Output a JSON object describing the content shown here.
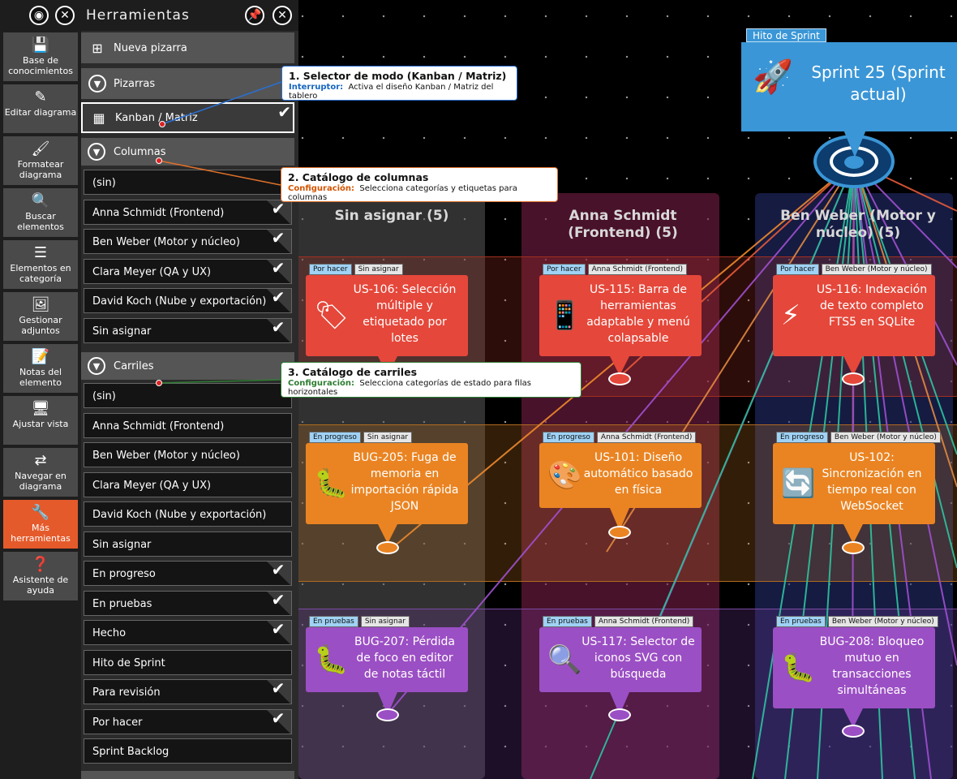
{
  "panel": {
    "title": "Herramientas"
  },
  "sidebar": {
    "items": [
      {
        "label": "Base de conocimientos",
        "icon": "save-icon"
      },
      {
        "label": "Editar diagrama",
        "icon": "pencil-icon"
      },
      {
        "label": "Formatear diagrama",
        "icon": "brush-icon"
      },
      {
        "label": "Buscar elementos",
        "icon": "search-icon"
      },
      {
        "label": "Elementos en categoría",
        "icon": "category-list-icon"
      },
      {
        "label": "Gestionar adjuntos",
        "icon": "image-attachment-icon"
      },
      {
        "label": "Notas del elemento",
        "icon": "notes-icon"
      },
      {
        "label": "Ajustar vista",
        "icon": "monitor-icon"
      },
      {
        "label": "Navegar en diagrama",
        "icon": "arrows-swap-icon"
      },
      {
        "label": "Más herramientas",
        "icon": "wrench-icon"
      },
      {
        "label": "Asistente de ayuda",
        "icon": "help-icon"
      }
    ]
  },
  "tools": {
    "new_board": "Nueva pizarra",
    "boards": "Pizarras",
    "kanban": "Kanban / Matriz",
    "columns_head": "Columnas",
    "lanes_head": "Carriles"
  },
  "columns": [
    {
      "label": "(sin)",
      "checked": false
    },
    {
      "label": "Anna Schmidt (Frontend)",
      "checked": true
    },
    {
      "label": "Ben Weber (Motor y núcleo)",
      "checked": true
    },
    {
      "label": "Clara Meyer (QA y UX)",
      "checked": true
    },
    {
      "label": "David Koch (Nube y exportación)",
      "checked": true
    },
    {
      "label": "Sin asignar",
      "checked": true
    }
  ],
  "lanes": [
    {
      "label": "(sin)",
      "checked": false
    },
    {
      "label": "Anna Schmidt (Frontend)",
      "checked": false
    },
    {
      "label": "Ben Weber (Motor y núcleo)",
      "checked": false
    },
    {
      "label": "Clara Meyer (QA y UX)",
      "checked": false
    },
    {
      "label": "David Koch (Nube y exportación)",
      "checked": false
    },
    {
      "label": "Sin asignar",
      "checked": false
    },
    {
      "label": "En progreso",
      "checked": true
    },
    {
      "label": "En pruebas",
      "checked": true
    },
    {
      "label": "Hecho",
      "checked": true
    },
    {
      "label": "Hito de Sprint",
      "checked": false
    },
    {
      "label": "Para revisión",
      "checked": true
    },
    {
      "label": "Por hacer",
      "checked": true
    },
    {
      "label": "Sprint Backlog",
      "checked": false
    }
  ],
  "callouts": [
    {
      "title": "1. Selector de modo (Kanban / Matriz)",
      "kind": "Interruptor:",
      "text": "Activa el diseño Kanban / Matriz del tablero",
      "kind_color": "#1565c0"
    },
    {
      "title": "2. Catálogo de columnas",
      "kind": "Configuración:",
      "text": "Selecciona categorías y etiquetas para columnas",
      "kind_color": "#d35400"
    },
    {
      "title": "3. Catálogo de carriles",
      "kind": "Configuración:",
      "text": "Selecciona categorías de estado para filas horizontales",
      "kind_color": "#2e7d32"
    }
  ],
  "board": {
    "milestone_tag": "Hito de Sprint",
    "milestone_title": "Sprint 25 (Sprint actual)",
    "columns": [
      "Sin asignar (5)",
      "Anna Schmidt (Frontend) (5)",
      "Ben Weber (Motor y núcleo) (5)"
    ],
    "cards": [
      {
        "status": "Por hacer",
        "owner": "Sin asignar",
        "title": "US-106: Selección múltiple y etiquetado por lotes",
        "icon": "tag-icon",
        "glyph": "🏷",
        "color": "#e5473a"
      },
      {
        "status": "Por hacer",
        "owner": "Anna Schmidt (Frontend)",
        "title": "US-115: Barra de herramientas adaptable y menú colapsable",
        "icon": "phone-icon",
        "glyph": "📱",
        "color": "#e5473a"
      },
      {
        "status": "Por hacer",
        "owner": "Ben Weber (Motor y núcleo)",
        "title": "US-116: Indexación de texto completo FTS5 en SQLite",
        "icon": "lightning-icon",
        "glyph": "⚡",
        "color": "#e5473a"
      },
      {
        "status": "En progreso",
        "owner": "Sin asignar",
        "title": "BUG-205: Fuga de memoria en importación rápida JSON",
        "icon": "bug-icon",
        "glyph": "🐛",
        "color": "#ea8422"
      },
      {
        "status": "En progreso",
        "owner": "Anna Schmidt (Frontend)",
        "title": "US-101: Diseño automático basado en física",
        "icon": "palette-icon",
        "glyph": "🎨",
        "color": "#ea8422"
      },
      {
        "status": "En progreso",
        "owner": "Ben Weber (Motor y núcleo)",
        "title": "US-102: Sincronización en tiempo real con WebSocket",
        "icon": "sync-icon",
        "glyph": "🔄",
        "color": "#ea8422"
      },
      {
        "status": "En pruebas",
        "owner": "Sin asignar",
        "title": "BUG-207: Pérdida de foco en editor de notas táctil",
        "icon": "bug-icon",
        "glyph": "🐛",
        "color": "#9b4fc4"
      },
      {
        "status": "En pruebas",
        "owner": "Anna Schmidt (Frontend)",
        "title": "US-117: Selector de iconos SVG con búsqueda",
        "icon": "magnifier-icon",
        "glyph": "🔍",
        "color": "#9b4fc4"
      },
      {
        "status": "En pruebas",
        "owner": "Ben Weber (Motor y núcleo)",
        "title": "BUG-208: Bloqueo mutuo en transacciones simultáneas",
        "icon": "bug-icon",
        "glyph": "🐛",
        "color": "#9b4fc4"
      }
    ]
  }
}
